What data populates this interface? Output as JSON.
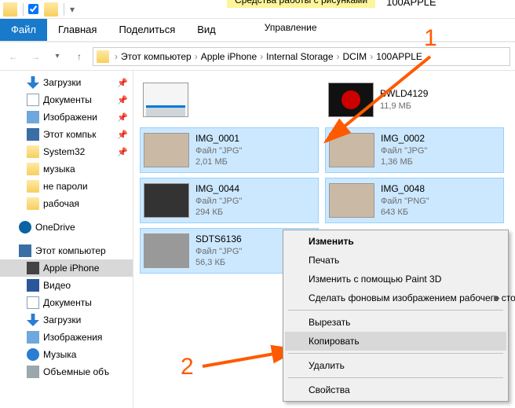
{
  "window_title": "100APPLE",
  "context_tab": {
    "group": "Средства работы с рисунками",
    "tab": "Управление"
  },
  "ribbon_tabs": {
    "file": "Файл",
    "home": "Главная",
    "share": "Поделиться",
    "view": "Вид"
  },
  "breadcrumbs": [
    "Этот компьютер",
    "Apple iPhone",
    "Internal Storage",
    "DCIM",
    "100APPLE"
  ],
  "sidebar": {
    "quick": [
      {
        "label": "Загрузки",
        "pinned": true,
        "icon": "ico-dl"
      },
      {
        "label": "Документы",
        "pinned": true,
        "icon": "ico-doc"
      },
      {
        "label": "Изображени",
        "pinned": true,
        "icon": "ico-img"
      },
      {
        "label": "Этот компьк",
        "pinned": true,
        "icon": "ico-pc"
      },
      {
        "label": "System32",
        "pinned": true,
        "icon": "ico-folder"
      },
      {
        "label": "музыка",
        "pinned": false,
        "icon": "ico-folder"
      },
      {
        "label": "не пароли",
        "pinned": false,
        "icon": "ico-folder"
      },
      {
        "label": "рабочая",
        "pinned": false,
        "icon": "ico-folder"
      }
    ],
    "onedrive": "OneDrive",
    "thispc": "Этот компьютер",
    "thispc_children": [
      {
        "label": "Apple iPhone",
        "icon": "ico-phone",
        "selected": true
      },
      {
        "label": "Видео",
        "icon": "ico-vid"
      },
      {
        "label": "Документы",
        "icon": "ico-doc"
      },
      {
        "label": "Загрузки",
        "icon": "ico-dl"
      },
      {
        "label": "Изображения",
        "icon": "ico-img"
      },
      {
        "label": "Музыка",
        "icon": "ico-music"
      },
      {
        "label": "Объемные объ",
        "icon": "ico-disk"
      }
    ]
  },
  "tiles": [
    {
      "name": "",
      "type": "",
      "size": "",
      "thumb": "drive",
      "selected": false
    },
    {
      "name": "BWLD4129",
      "type": "",
      "size": "11,9 МБ",
      "thumb": "video",
      "selected": false
    },
    {
      "name": "IMG_0001",
      "type": "Файл \"JPG\"",
      "size": "2,01 МБ",
      "thumb": "plain",
      "selected": true
    },
    {
      "name": "IMG_0002",
      "type": "Файл \"JPG\"",
      "size": "1,36 МБ",
      "thumb": "plain",
      "selected": true
    },
    {
      "name": "IMG_0044",
      "type": "Файл \"JPG\"",
      "size": "294 КБ",
      "thumb": "dark",
      "selected": true
    },
    {
      "name": "IMG_0048",
      "type": "Файл \"PNG\"",
      "size": "643 КБ",
      "thumb": "plain",
      "selected": true
    },
    {
      "name": "SDTS6136",
      "type": "Файл \"JPG\"",
      "size": "56,3 КБ",
      "thumb": "grey",
      "selected": true
    }
  ],
  "context_menu": [
    {
      "label": "Изменить",
      "bold": true
    },
    {
      "label": "Печать"
    },
    {
      "label": "Изменить с помощью Paint 3D"
    },
    {
      "label": "Сделать фоновым изображением рабочего стола",
      "submenu": true
    },
    {
      "sep": true
    },
    {
      "label": "Вырезать"
    },
    {
      "label": "Копировать",
      "hover": true
    },
    {
      "sep": true
    },
    {
      "label": "Удалить"
    },
    {
      "sep": true
    },
    {
      "label": "Свойства"
    }
  ],
  "annotations": {
    "n1": "1",
    "n2": "2"
  }
}
